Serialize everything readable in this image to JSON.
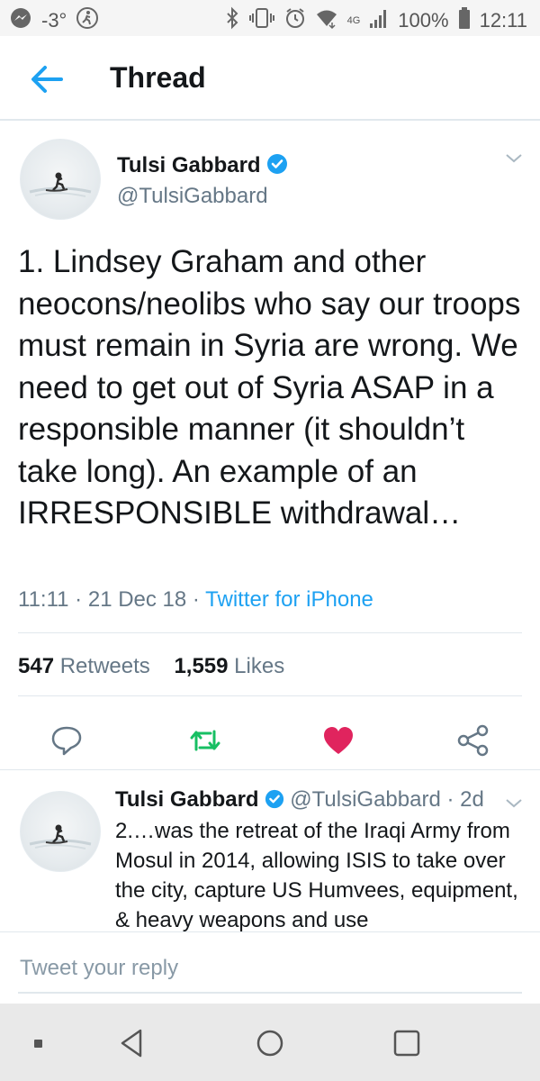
{
  "status_bar": {
    "temperature": "-3°",
    "network": "4G",
    "battery": "100%",
    "time": "12:11",
    "icons": [
      "messenger-icon",
      "activity-icon",
      "bluetooth-icon",
      "vibrate-icon",
      "alarm-icon",
      "wifi-icon",
      "signal-icon",
      "battery-icon"
    ]
  },
  "header": {
    "title": "Thread",
    "back_icon": "back-arrow-icon"
  },
  "main_tweet": {
    "author_name": "Tulsi Gabbard",
    "handle": "@TulsiGabbard",
    "text": "1. Lindsey Graham and other neocons/neolibs who say our troops must remain in Syria are wrong. We need to get out of Syria ASAP in a responsible manner (it shouldn’t take long). An example of an IRRESPONSIBLE withdrawal…",
    "time": "11:11",
    "date": "21 Dec 18",
    "source": "Twitter for iPhone",
    "retweets_count": "547",
    "retweets_label": "Retweets",
    "likes_count": "1,559",
    "likes_label": "Likes"
  },
  "reply_tweet": {
    "author_name": "Tulsi Gabbard",
    "handle": "@TulsiGabbard",
    "age": "2d",
    "text": "2.…was the retreat of the Iraqi Army from Mosul in 2014, allowing ISIS to take over the city, capture US Humvees, equipment, & heavy weapons and use"
  },
  "reply_box": {
    "placeholder": "Tweet your reply"
  },
  "colors": {
    "accent": "#1da1f2",
    "retweet": "#17bf63",
    "like": "#e0245e",
    "secondary_text": "#657786"
  }
}
